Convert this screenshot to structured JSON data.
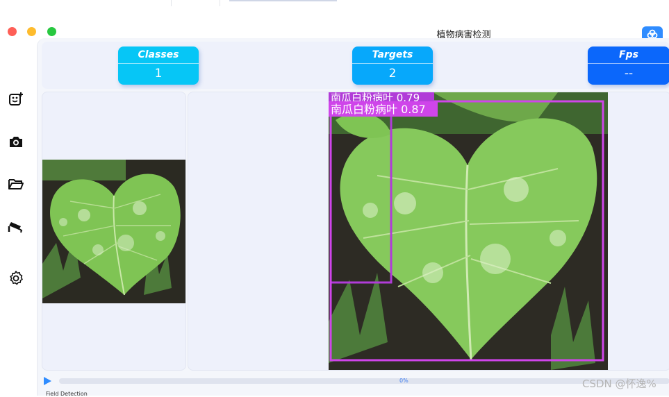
{
  "window": {
    "title": "植物病害检测"
  },
  "sidebar": {
    "items": [
      {
        "icon": "image-add-icon"
      },
      {
        "icon": "camera-icon"
      },
      {
        "icon": "folder-open-icon"
      },
      {
        "icon": "video-camera-icon"
      },
      {
        "icon": "settings-gear-icon"
      }
    ]
  },
  "stats": {
    "classes": {
      "label": "Classes",
      "value": "1",
      "color": "#06c6f6"
    },
    "targets": {
      "label": "Targets",
      "value": "2",
      "color": "#07a8fb"
    },
    "fps": {
      "label": "Fps",
      "value": "--",
      "color": "#0b67fb"
    }
  },
  "detections": [
    {
      "label": "南瓜白粉病叶 0.79",
      "box_color": "#b13cd8"
    },
    {
      "label": "南瓜白粉病叶 0.87",
      "box_color": "#cf45ea"
    }
  ],
  "progress": {
    "percent_text": "0%",
    "value": 0
  },
  "bottom_text": "Field Detection",
  "watermark": "CSDN @怀逸%"
}
